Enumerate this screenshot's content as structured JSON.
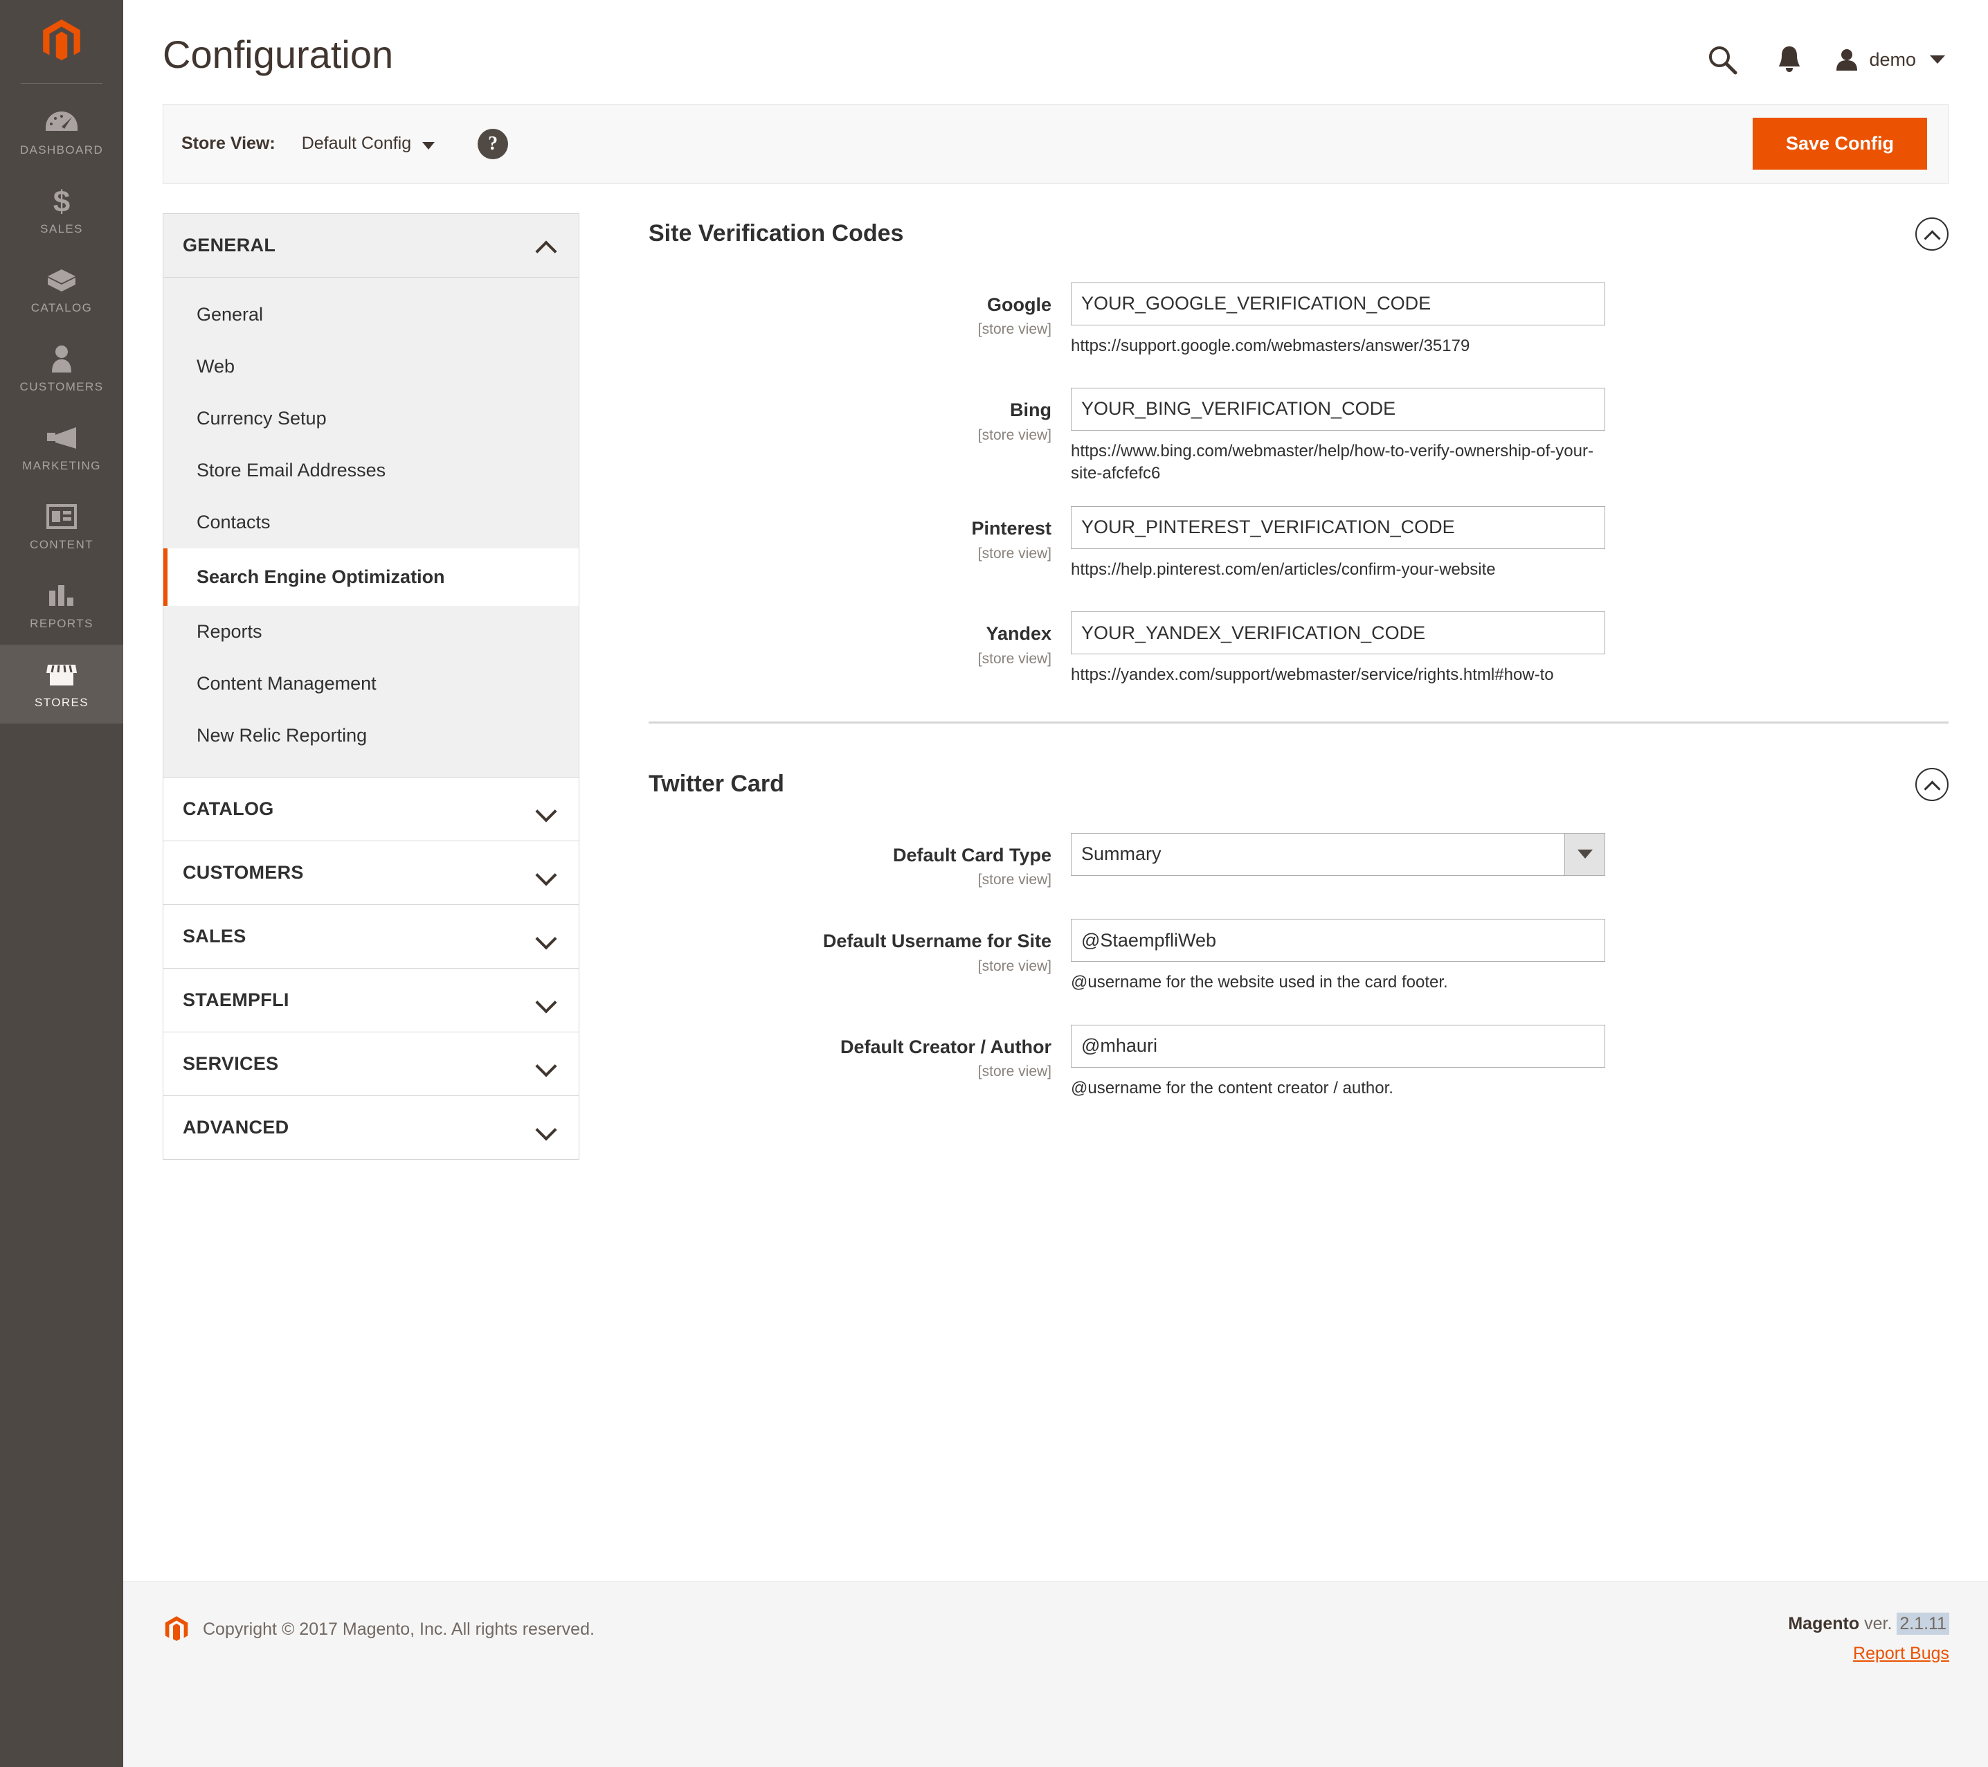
{
  "adminnav": {
    "logo_label": "magento-logo",
    "items": [
      {
        "label": "DASHBOARD",
        "icon": "dashboard-icon",
        "active": false
      },
      {
        "label": "SALES",
        "icon": "dollar-icon",
        "active": false
      },
      {
        "label": "CATALOG",
        "icon": "box-icon",
        "active": false
      },
      {
        "label": "CUSTOMERS",
        "icon": "person-icon",
        "active": false
      },
      {
        "label": "MARKETING",
        "icon": "megaphone-icon",
        "active": false
      },
      {
        "label": "CONTENT",
        "icon": "layout-icon",
        "active": false
      },
      {
        "label": "REPORTS",
        "icon": "bar-chart-icon",
        "active": false
      },
      {
        "label": "STORES",
        "icon": "storefront-icon",
        "active": true
      }
    ]
  },
  "header": {
    "title": "Configuration",
    "search_icon": "search-icon",
    "notifications_icon": "bell-icon",
    "user_name": "demo"
  },
  "storebar": {
    "store_view_label": "Store View:",
    "store_view_value": "Default Config",
    "help_label": "?",
    "save_label": "Save Config"
  },
  "confignav": {
    "sections": [
      {
        "label": "GENERAL",
        "open": true,
        "items": [
          {
            "label": "General",
            "active": false
          },
          {
            "label": "Web",
            "active": false
          },
          {
            "label": "Currency Setup",
            "active": false
          },
          {
            "label": "Store Email Addresses",
            "active": false
          },
          {
            "label": "Contacts",
            "active": false
          },
          {
            "label": "Search Engine Optimization",
            "active": true
          },
          {
            "label": "Reports",
            "active": false
          },
          {
            "label": "Content Management",
            "active": false
          },
          {
            "label": "New Relic Reporting",
            "active": false
          }
        ]
      },
      {
        "label": "CATALOG",
        "open": false,
        "items": []
      },
      {
        "label": "CUSTOMERS",
        "open": false,
        "items": []
      },
      {
        "label": "SALES",
        "open": false,
        "items": []
      },
      {
        "label": "STAEMPFLI",
        "open": false,
        "items": []
      },
      {
        "label": "SERVICES",
        "open": false,
        "items": []
      },
      {
        "label": "ADVANCED",
        "open": false,
        "items": []
      }
    ]
  },
  "site_verification": {
    "title": "Site Verification Codes",
    "scope": "[store view]",
    "google": {
      "label": "Google",
      "value": "YOUR_GOOGLE_VERIFICATION_CODE",
      "note": "https://support.google.com/webmasters/answer/35179"
    },
    "bing": {
      "label": "Bing",
      "value": "YOUR_BING_VERIFICATION_CODE",
      "note": "https://www.bing.com/webmaster/help/how-to-verify-ownership-of-your-site-afcfefc6"
    },
    "pinterest": {
      "label": "Pinterest",
      "value": "YOUR_PINTEREST_VERIFICATION_CODE",
      "note": "https://help.pinterest.com/en/articles/confirm-your-website"
    },
    "yandex": {
      "label": "Yandex",
      "value": "YOUR_YANDEX_VERIFICATION_CODE",
      "note": "https://yandex.com/support/webmaster/service/rights.html#how-to"
    }
  },
  "twitter_card": {
    "title": "Twitter Card",
    "scope": "[store view]",
    "card_type": {
      "label": "Default Card Type",
      "value": "Summary"
    },
    "username_site": {
      "label": "Default Username for Site",
      "value": "@StaempfliWeb",
      "note": "@username for the website used in the card footer."
    },
    "creator": {
      "label": "Default Creator / Author",
      "value": "@mhauri",
      "note": "@username for the content creator / author."
    }
  },
  "footer": {
    "copyright": "Copyright © 2017 Magento, Inc. All rights reserved.",
    "brand": "Magento",
    "ver_word": "ver.",
    "version": "2.1.11",
    "report_bugs": "Report Bugs"
  },
  "colors": {
    "accent_orange": "#eb5202",
    "nav_dark": "#4e4844",
    "text_dark": "#303030",
    "selection_blue": "#c7d3e0"
  }
}
